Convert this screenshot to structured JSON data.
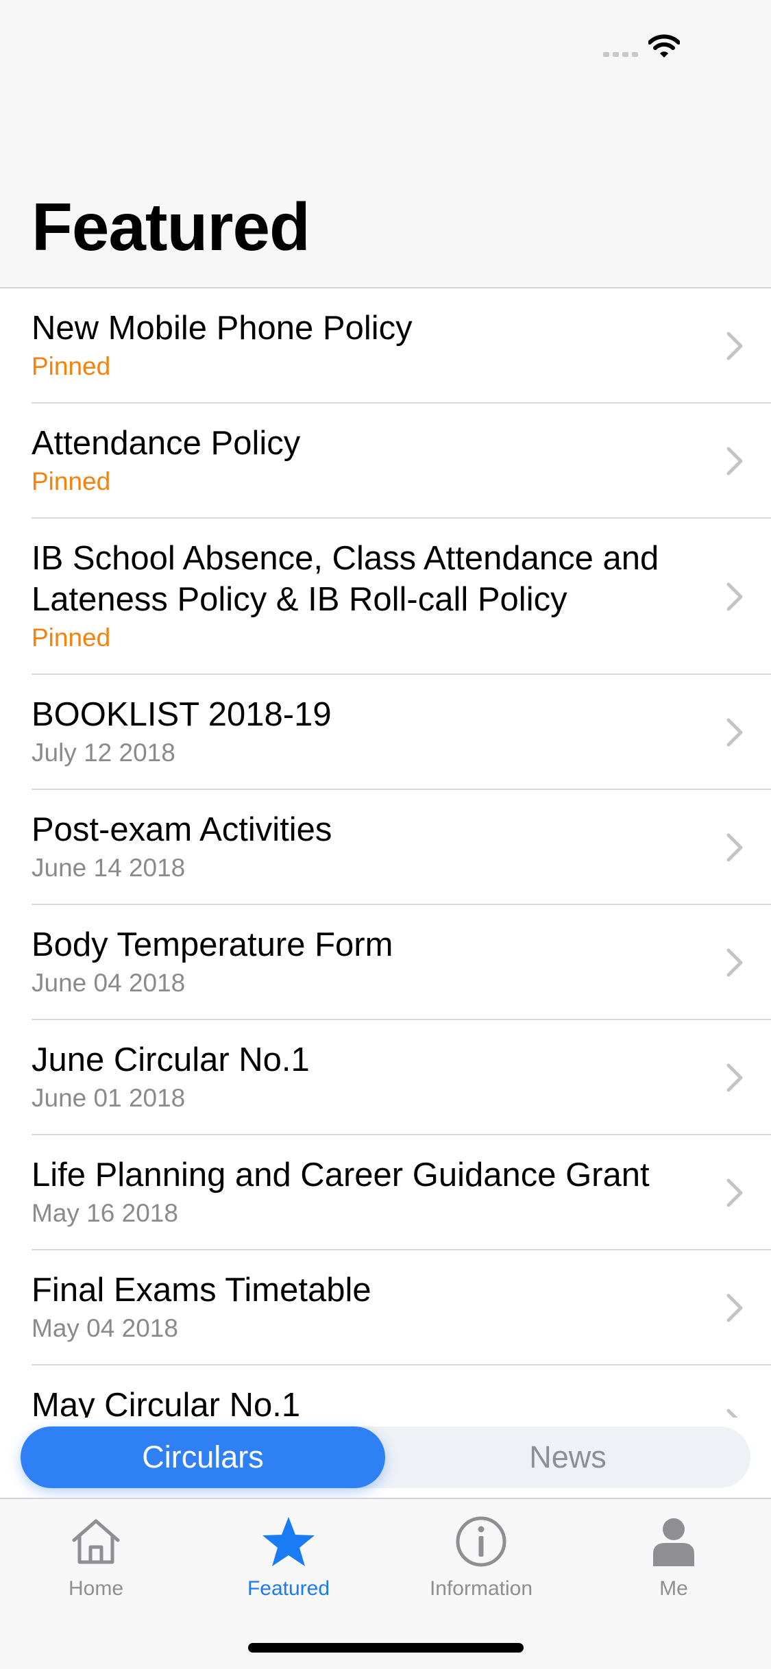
{
  "status_bar": {
    "icons": [
      "signal-dots-icon",
      "wifi-icon"
    ]
  },
  "header": {
    "title": "Featured"
  },
  "list": {
    "items": [
      {
        "title": "New Mobile Phone Policy",
        "subtitle": "Pinned",
        "pinned": true
      },
      {
        "title": "Attendance Policy",
        "subtitle": "Pinned",
        "pinned": true
      },
      {
        "title": "IB School Absence, Class Attendance and Lateness Policy & IB Roll-call Policy",
        "subtitle": "Pinned",
        "pinned": true
      },
      {
        "title": "BOOKLIST 2018-19",
        "subtitle": "July 12 2018",
        "pinned": false
      },
      {
        "title": "Post-exam Activities",
        "subtitle": "June 14 2018",
        "pinned": false
      },
      {
        "title": "Body Temperature Form",
        "subtitle": "June 04 2018",
        "pinned": false
      },
      {
        "title": "June Circular No.1",
        "subtitle": "June 01 2018",
        "pinned": false
      },
      {
        "title": "Life Planning and Career Guidance Grant",
        "subtitle": "May 16 2018",
        "pinned": false
      },
      {
        "title": "Final Exams Timetable",
        "subtitle": "May 04 2018",
        "pinned": false
      },
      {
        "title": "May Circular No.1",
        "subtitle": "",
        "pinned": false
      }
    ]
  },
  "segmented": {
    "options": [
      "Circulars",
      "News"
    ],
    "selected": "Circulars"
  },
  "tab_bar": {
    "tabs": [
      {
        "label": "Home",
        "icon": "home-icon",
        "active": false
      },
      {
        "label": "Featured",
        "icon": "star-icon",
        "active": true
      },
      {
        "label": "Information",
        "icon": "info-icon",
        "active": false
      },
      {
        "label": "Me",
        "icon": "person-icon",
        "active": false
      }
    ]
  },
  "colors": {
    "accent": "#2f80f5",
    "tab_active": "#1a7cf5",
    "pinned": "#f5820b",
    "secondary_text": "#8a8a8e",
    "separator": "#d9d9de",
    "bar_background": "#f7f7f7"
  }
}
